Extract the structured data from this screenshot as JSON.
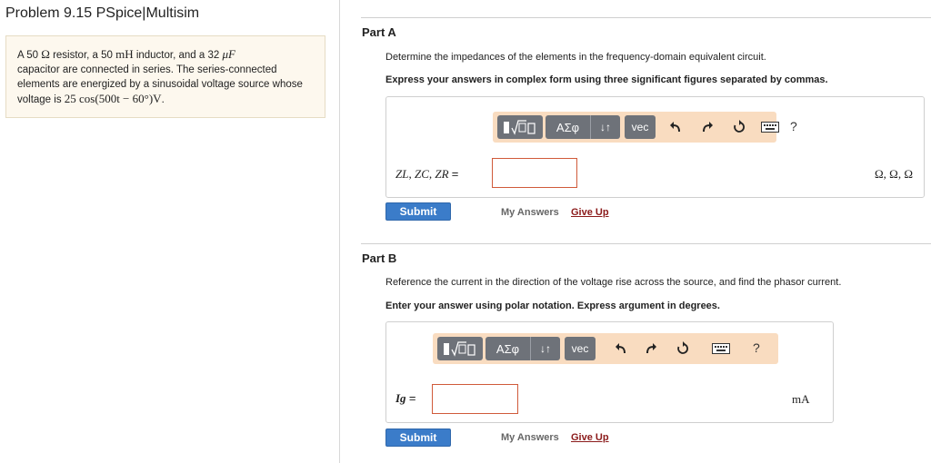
{
  "problem": {
    "title": "Problem 9.15 PSpice|Multisim",
    "text_part1": "A 50 ",
    "ohm": "Ω",
    "text_part2": " resistor, a 50 ",
    "mH": "mH",
    "text_part3": " inductor, and a 32 ",
    "uF": "μF",
    "text_part4": "capacitor are connected in series. The series-connected elements are energized by a sinusoidal voltage source whose voltage is ",
    "voltage_expr": "25 cos(500t − 60°)V",
    "text_end": "."
  },
  "part_a": {
    "title": "Part A",
    "instruction": "Determine the impedances of the elements in the frequency-domain equivalent circuit.",
    "instruction_bold": "Express your answers in complex form using three significant figures separated by commas.",
    "label": "Z",
    "label_full": "ZL, ZC, ZR",
    "equals": "=",
    "input_value": "",
    "units": "Ω, Ω, Ω",
    "toolbar": {
      "vec_label": "vec",
      "greek_label": "ΑΣφ",
      "sort_label": "↓↑",
      "help_label": "?"
    },
    "submit_label": "Submit",
    "my_answers_label": "My Answers",
    "give_up_label": "Give Up"
  },
  "part_b": {
    "title": "Part B",
    "instruction": "Reference the current in the direction of the voltage rise across the source, and find the phasor current.",
    "instruction_bold": "Enter your answer using polar notation. Express argument in degrees.",
    "label": "Ig",
    "equals": "=",
    "input_value": "",
    "units": "mA",
    "toolbar": {
      "vec_label": "vec",
      "greek_label": "ΑΣφ",
      "sort_label": "↓↑",
      "help_label": "?"
    },
    "submit_label": "Submit",
    "my_answers_label": "My Answers",
    "give_up_label": "Give Up"
  },
  "colors": {
    "toolbar_bg": "#f9dcc0",
    "button_gray": "#6e7279",
    "submit_blue": "#3b7cc9",
    "give_up_red": "#8b1a1a",
    "input_border": "#d05a3a",
    "problem_bg": "#fdf8ee"
  },
  "icons": [
    "template-icon",
    "sqrt-icon",
    "undo-icon",
    "redo-icon",
    "reset-icon",
    "keyboard-icon"
  ]
}
